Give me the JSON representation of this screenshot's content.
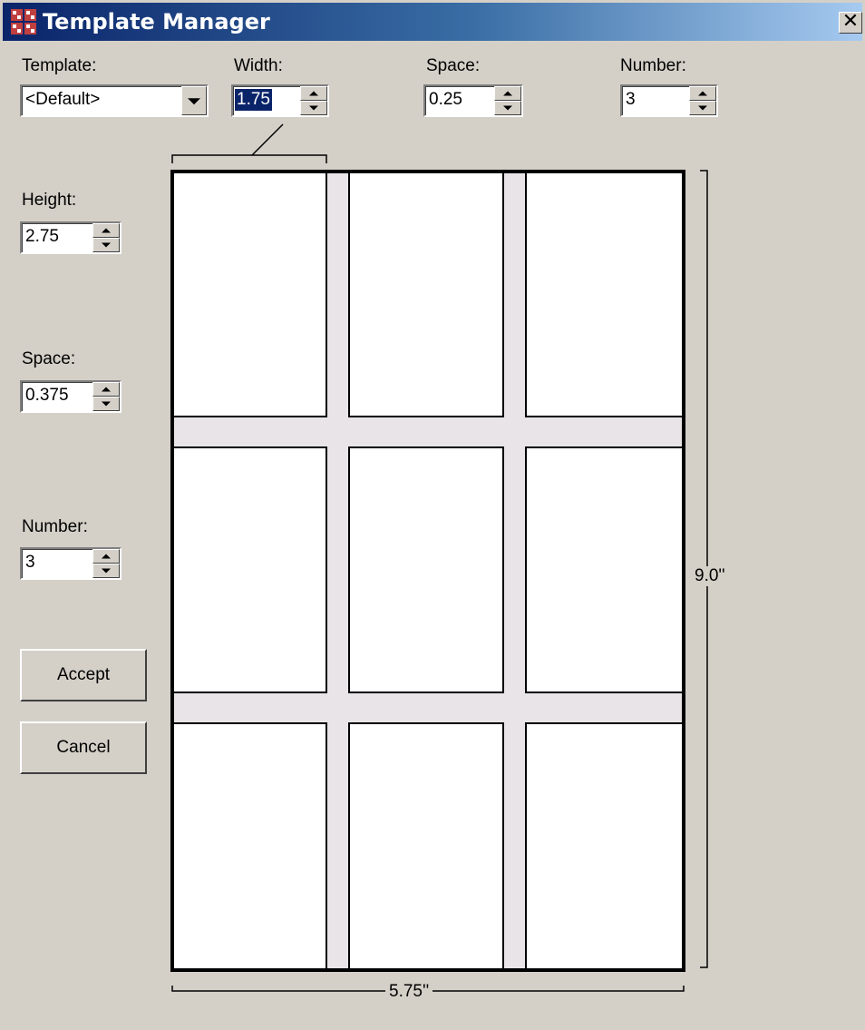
{
  "window": {
    "title": "Template Manager",
    "close_label": "✕"
  },
  "template": {
    "label": "Template:",
    "value": "<Default>"
  },
  "width": {
    "label": "Width:",
    "value": "1.75"
  },
  "col_space": {
    "label": "Space:",
    "value": "0.25"
  },
  "col_number": {
    "label": "Number:",
    "value": "3"
  },
  "height": {
    "label": "Height:",
    "value": "2.75"
  },
  "row_space": {
    "label": "Space:",
    "value": "0.375"
  },
  "row_number": {
    "label": "Number:",
    "value": "3"
  },
  "buttons": {
    "accept": "Accept",
    "cancel": "Cancel"
  },
  "preview": {
    "columns": 3,
    "rows": 3,
    "total_height_label": "9.0''",
    "total_width_label": "5.75''",
    "cell_color": "#ffffff",
    "gap_color": "#e8e4e8"
  },
  "icons": {
    "app": "template-grid-icon",
    "close": "close-icon"
  },
  "colors": {
    "titlebar_start": "#0a246a",
    "titlebar_end": "#a6caf0",
    "selection": "#0a246a"
  }
}
